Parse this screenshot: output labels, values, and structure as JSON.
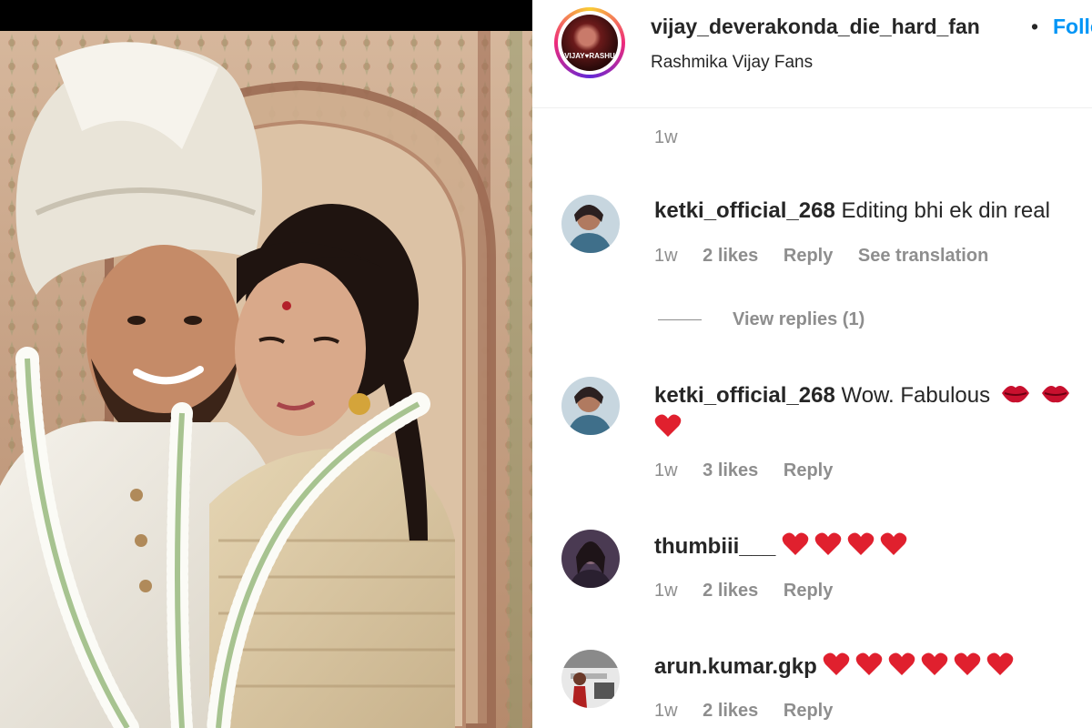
{
  "post": {
    "username": "vijay_deverakonda_die_hard_fan",
    "separator": "•",
    "follow_label": "Follow",
    "subtitle": "Rashmika Vijay Fans",
    "avatar_text": "VIJAY♥RASHU",
    "time": "1w"
  },
  "comments": [
    {
      "username": "ketki_official_268",
      "text": "Editing bhi ek din real",
      "time": "1w",
      "likes": "2 likes",
      "reply": "Reply",
      "translate": "See translation",
      "emoji": []
    },
    {
      "username": "ketki_official_268",
      "text": "Wow. Fabulous",
      "time": "1w",
      "likes": "3 likes",
      "reply": "Reply",
      "emoji": [
        "lips-icon",
        "lips-icon",
        "heart-icon"
      ]
    },
    {
      "username": "thumbiii___",
      "text": "",
      "time": "1w",
      "likes": "2 likes",
      "reply": "Reply",
      "emoji": [
        "heart-icon",
        "heart-icon",
        "heart-icon",
        "heart-icon"
      ]
    },
    {
      "username": "arun.kumar.gkp",
      "text": "",
      "time": "1w",
      "likes": "2 likes",
      "reply": "Reply",
      "emoji": [
        "heart-icon",
        "heart-icon",
        "heart-icon",
        "heart-icon",
        "heart-icon",
        "heart-icon"
      ]
    }
  ],
  "view_replies": "View replies (1)",
  "colors": {
    "link": "#0095f6",
    "text": "#262626",
    "muted": "#8e8e8e",
    "heart": "#e0202e"
  }
}
